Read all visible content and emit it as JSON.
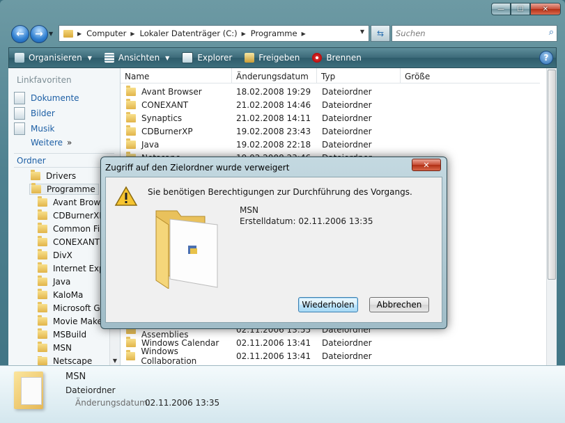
{
  "window": {
    "caption_buttons": {
      "minimize": "—",
      "maximize": "☐",
      "close": "✕"
    }
  },
  "address_bar": {
    "crumbs": [
      "Computer",
      "Lokaler Datenträger (C:)",
      "Programme"
    ],
    "search_placeholder": "Suchen"
  },
  "toolbar": {
    "items": [
      "Organisieren",
      "Ansichten",
      "Explorer",
      "Freigeben",
      "Brennen"
    ],
    "help": "?"
  },
  "sidebar": {
    "favorites_header": "Linkfavoriten",
    "favorites": [
      "Dokumente",
      "Bilder",
      "Musik"
    ],
    "more": "Weitere",
    "more_glyph": "»",
    "folders_header": "Ordner",
    "tree": [
      "Drivers",
      "Programme",
      "Avant Browser",
      "CDBurnerXP",
      "Common Files",
      "CONEXANT",
      "DivX",
      "Internet Explorer",
      "Java",
      "KaloMa",
      "Microsoft Games",
      "Movie Maker",
      "MSBuild",
      "MSN",
      "Netscape"
    ]
  },
  "columns": [
    "Name",
    "Änderungsdatum",
    "Typ",
    "Größe"
  ],
  "files_top": [
    {
      "name": "Avant Browser",
      "date": "18.02.2008 19:29",
      "type": "Dateiordner"
    },
    {
      "name": "CONEXANT",
      "date": "21.02.2008 14:46",
      "type": "Dateiordner"
    },
    {
      "name": "Synaptics",
      "date": "21.02.2008 14:11",
      "type": "Dateiordner"
    },
    {
      "name": "CDBurnerXP",
      "date": "19.02.2008 23:43",
      "type": "Dateiordner"
    },
    {
      "name": "Java",
      "date": "19.02.2008 22:18",
      "type": "Dateiordner"
    },
    {
      "name": "Netscape",
      "date": "19.02.2008 23:46",
      "type": "Dateiordner"
    }
  ],
  "files_bottom": [
    {
      "name": "Reference Assemblies",
      "date": "02.11.2006 13:55",
      "type": "Dateiordner"
    },
    {
      "name": "Windows Calendar",
      "date": "02.11.2006 13:41",
      "type": "Dateiordner"
    },
    {
      "name": "Windows Collaboration",
      "date": "02.11.2006 13:41",
      "type": "Dateiordner"
    }
  ],
  "details": {
    "name": "MSN",
    "type": "Dateiordner",
    "modified_label": "Änderungsdatum:",
    "modified_value": "02.11.2006 13:35"
  },
  "dialog": {
    "title": "Zugriff auf den Zielordner wurde verweigert",
    "message": "Sie benötigen Berechtigungen zur Durchführung des Vorgangs.",
    "item_name": "MSN",
    "item_created": "Erstelldatum: 02.11.2006 13:35",
    "retry": "Wiederholen",
    "cancel": "Abbrechen",
    "close_glyph": "✕"
  },
  "icons": {
    "back": "back-arrow-icon",
    "forward": "forward-arrow-icon",
    "warning": "warning-icon",
    "folder": "folder-icon"
  }
}
